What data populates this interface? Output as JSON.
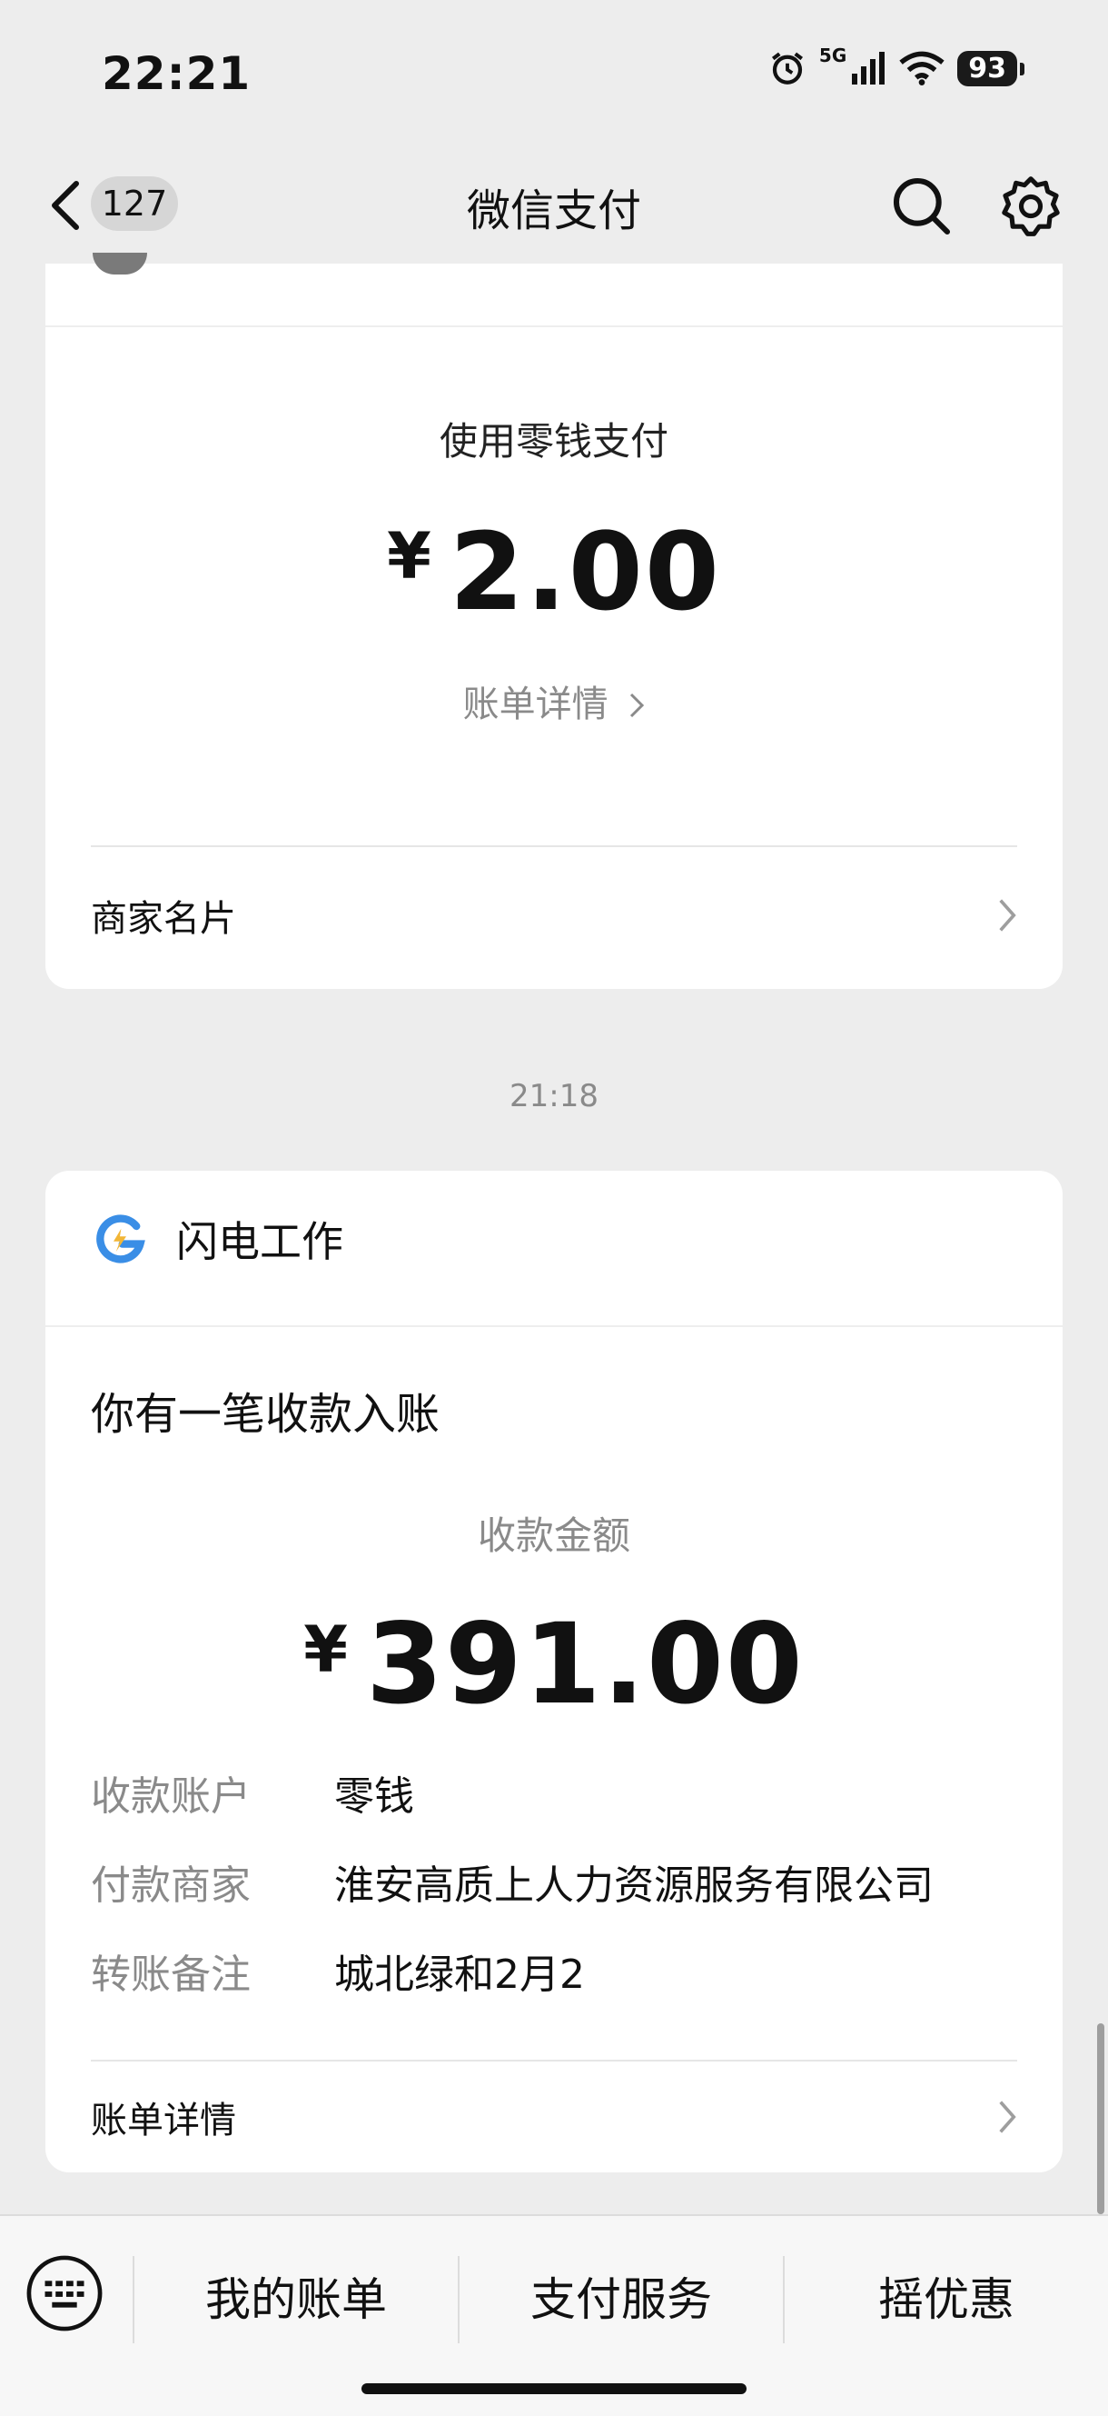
{
  "status_bar": {
    "time": "22:21",
    "network": "5G",
    "battery": "93"
  },
  "nav": {
    "badge": "127",
    "title": "微信支付"
  },
  "card1": {
    "pay_method": "使用零钱支付",
    "currency": "¥",
    "amount": "2.00",
    "bill_detail": "账单详情",
    "merchant_card": "商家名片"
  },
  "timestamp": "21:18",
  "card2": {
    "merchant_name": "闪电工作",
    "notice_title": "你有一笔收款入账",
    "received_label": "收款金额",
    "currency": "¥",
    "amount": "391.00",
    "details": [
      {
        "label": "收款账户",
        "value": "零钱"
      },
      {
        "label": "付款商家",
        "value": "淮安高质上人力资源服务有限公司"
      },
      {
        "label": "转账备注",
        "value": "城北绿和2月2"
      }
    ],
    "bill_detail": "账单详情"
  },
  "bottom_menu": {
    "items": [
      "我的账单",
      "支付服务",
      "摇优惠"
    ]
  },
  "colors": {
    "background": "#ededed",
    "card": "#ffffff",
    "muted_text": "#8a8a8a",
    "logo_blue": "#3a8ee6"
  }
}
